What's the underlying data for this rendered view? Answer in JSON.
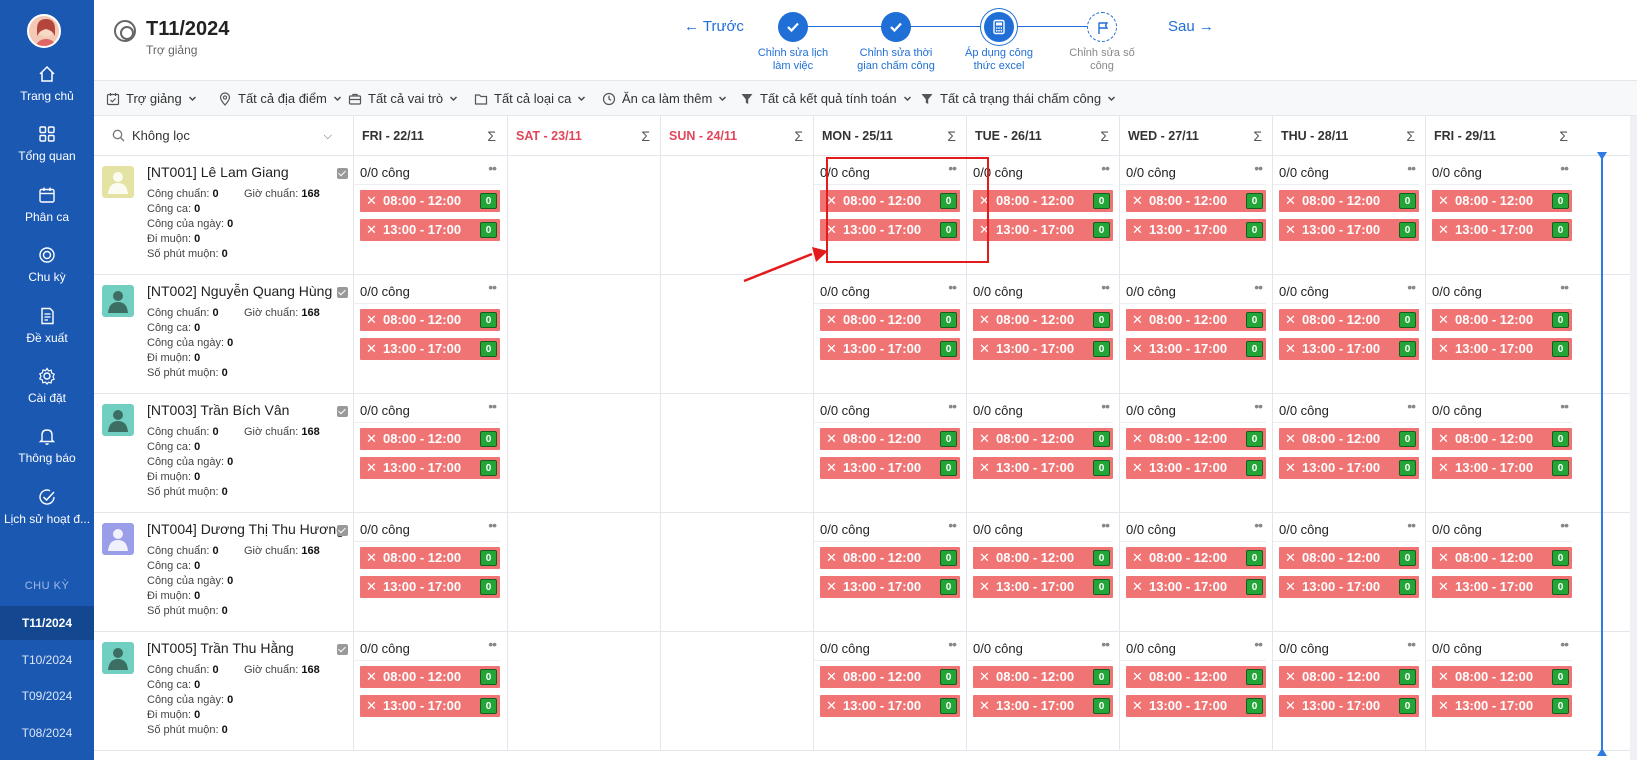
{
  "sidebar": {
    "items": [
      {
        "label": "Trang chủ",
        "icon": "home-icon"
      },
      {
        "label": "Tổng quan",
        "icon": "grid-icon"
      },
      {
        "label": "Phân ca",
        "icon": "calendar-icon"
      },
      {
        "label": "Chu kỳ",
        "icon": "circle-icon"
      },
      {
        "label": "Đề xuất",
        "icon": "document-icon"
      },
      {
        "label": "Cài đặt",
        "icon": "gear-icon"
      },
      {
        "label": "Thông báo",
        "icon": "bell-icon"
      },
      {
        "label": "Lịch sử hoạt đ...",
        "icon": "check-circle-icon"
      }
    ],
    "section_label": "CHU KỲ",
    "cycles": [
      "T11/2024",
      "T10/2024",
      "T09/2024",
      "T08/2024"
    ],
    "active_cycle": "T11/2024"
  },
  "header": {
    "title": "T11/2024",
    "subtitle": "Trợ giảng",
    "prev_label": "← Trước",
    "next_label": "Sau →",
    "steps": [
      {
        "label_1": "Chỉnh sửa lịch",
        "label_2": "làm việc",
        "state": "done"
      },
      {
        "label_1": "Chỉnh sửa thời",
        "label_2": "gian chấm công",
        "state": "done"
      },
      {
        "label_1": "Áp dụng công",
        "label_2": "thức excel",
        "state": "current"
      },
      {
        "label_1": "Chỉnh sửa số",
        "label_2": "công",
        "state": "pending"
      }
    ]
  },
  "filters": [
    "Trợ giảng",
    "Tất cả địa điểm",
    "Tất cả vai trò",
    "Tất cả loại ca",
    "Ăn ca làm thêm",
    "Tất cả kết quả tính toán",
    "Tất cả trạng thái chấm công"
  ],
  "search": {
    "value": "Không lọc"
  },
  "days": [
    {
      "label": "FRI - 22/11",
      "weekend": false
    },
    {
      "label": "SAT - 23/11",
      "weekend": true
    },
    {
      "label": "SUN - 24/11",
      "weekend": true
    },
    {
      "label": "MON - 25/11",
      "weekend": false
    },
    {
      "label": "TUE - 26/11",
      "weekend": false
    },
    {
      "label": "WED - 27/11",
      "weekend": false
    },
    {
      "label": "THU - 28/11",
      "weekend": false
    },
    {
      "label": "FRI - 29/11",
      "weekend": false
    }
  ],
  "sigma": "Σ",
  "meta_labels": {
    "cong_chuan": "Công chuẩn:",
    "gio_chuan": "Giờ chuẩn:",
    "cong_ca": "Công ca:",
    "cong_ngay": "Công của ngày:",
    "di_muon": "Đi muộn:",
    "so_phut_muon": "Số phút muộn:"
  },
  "cell": {
    "summary": "0/0 công",
    "more": "••",
    "shifts": [
      "08:00 - 12:00",
      "13:00 - 17:00"
    ],
    "badge": "0",
    "x": "✕"
  },
  "employees": [
    {
      "name": "[NT001] Lê Lam Giang",
      "cong_chuan": "0",
      "gio_chuan": "168",
      "cong_ca": "0",
      "cong_ngay": "0",
      "di_muon": "0",
      "so_phut_muon": "0",
      "avatar_color": "#e5e3a4"
    },
    {
      "name": "[NT002] Nguyễn Quang Hùng",
      "cong_chuan": "0",
      "gio_chuan": "168",
      "cong_ca": "0",
      "cong_ngay": "0",
      "di_muon": "0",
      "so_phut_muon": "0",
      "avatar_color": "#70cfc0"
    },
    {
      "name": "[NT003] Trần Bích Vân",
      "cong_chuan": "0",
      "gio_chuan": "168",
      "cong_ca": "0",
      "cong_ngay": "0",
      "di_muon": "0",
      "so_phut_muon": "0",
      "avatar_color": "#70cfc0"
    },
    {
      "name": "[NT004] Dương Thị Thu Hương",
      "cong_chuan": "0",
      "gio_chuan": "168",
      "cong_ca": "0",
      "cong_ngay": "0",
      "di_muon": "0",
      "so_phut_muon": "0",
      "avatar_color": "#9a9ee8"
    },
    {
      "name": "[NT005] Trần Thu Hằng",
      "cong_chuan": "0",
      "gio_chuan": "168",
      "cong_ca": "0",
      "cong_ngay": "0",
      "di_muon": "0",
      "so_phut_muon": "0",
      "avatar_color": "#70cfc0"
    }
  ],
  "colors": {
    "sidebar": "#1b58b2",
    "accent": "#1f6fd6",
    "shift": "#f07474",
    "badge": "#23a537",
    "highlight": "#e31b1b"
  }
}
